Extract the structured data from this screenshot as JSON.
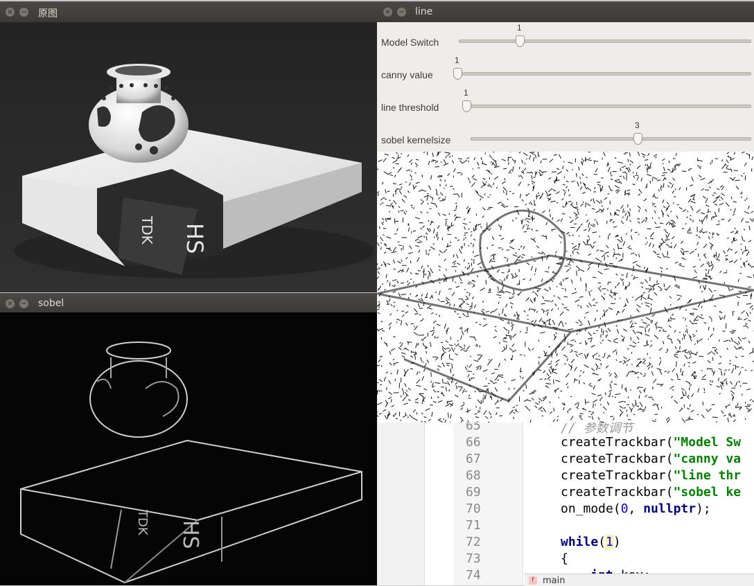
{
  "windows": {
    "original": {
      "title": "原图",
      "close": "×",
      "minimize": "−"
    },
    "sobel": {
      "title": "sobel",
      "close": "×",
      "minimize": "−"
    },
    "line": {
      "title": "line",
      "close": "×",
      "minimize": "−"
    }
  },
  "product_text": {
    "brand": "TDK",
    "model": "HS"
  },
  "trackbars": [
    {
      "label": "Model Switch",
      "value": "1"
    },
    {
      "label": "canny value",
      "value": "1"
    },
    {
      "label": "line threshold",
      "value": "1"
    },
    {
      "label": "sobel kernelsize",
      "value": "3"
    }
  ],
  "editor": {
    "lines": [
      {
        "n": "65",
        "parts": [
          [
            "plain",
            "// 参数调节"
          ]
        ]
      },
      {
        "n": "66",
        "parts": [
          [
            "plain",
            "createTrackbar("
          ],
          [
            "str",
            "\"Model Sw"
          ]
        ]
      },
      {
        "n": "67",
        "parts": [
          [
            "plain",
            "createTrackbar("
          ],
          [
            "str",
            "\"canny va"
          ]
        ]
      },
      {
        "n": "68",
        "parts": [
          [
            "plain",
            "createTrackbar("
          ],
          [
            "str",
            "\"line thr"
          ]
        ]
      },
      {
        "n": "69",
        "parts": [
          [
            "plain",
            "createTrackbar("
          ],
          [
            "str",
            "\"sobel ke"
          ]
        ]
      },
      {
        "n": "70",
        "parts": [
          [
            "plain",
            "on_mode("
          ],
          [
            "num",
            "0"
          ],
          [
            "plain",
            ", "
          ],
          [
            "kw",
            "nullptr"
          ],
          [
            "plain",
            ");"
          ]
        ]
      },
      {
        "n": "71",
        "parts": []
      },
      {
        "n": "72",
        "parts": [
          [
            "kw",
            "while"
          ],
          [
            "plain",
            "("
          ],
          [
            "numhl",
            "1"
          ],
          [
            "plain",
            ")"
          ]
        ]
      },
      {
        "n": "73",
        "parts": [
          [
            "plain",
            "{"
          ]
        ]
      },
      {
        "n": "74",
        "parts": [
          [
            "plain",
            "    "
          ],
          [
            "kw",
            "int"
          ],
          [
            "plain",
            " key;"
          ]
        ]
      }
    ],
    "tab": {
      "icon": "f",
      "name": "main"
    }
  }
}
